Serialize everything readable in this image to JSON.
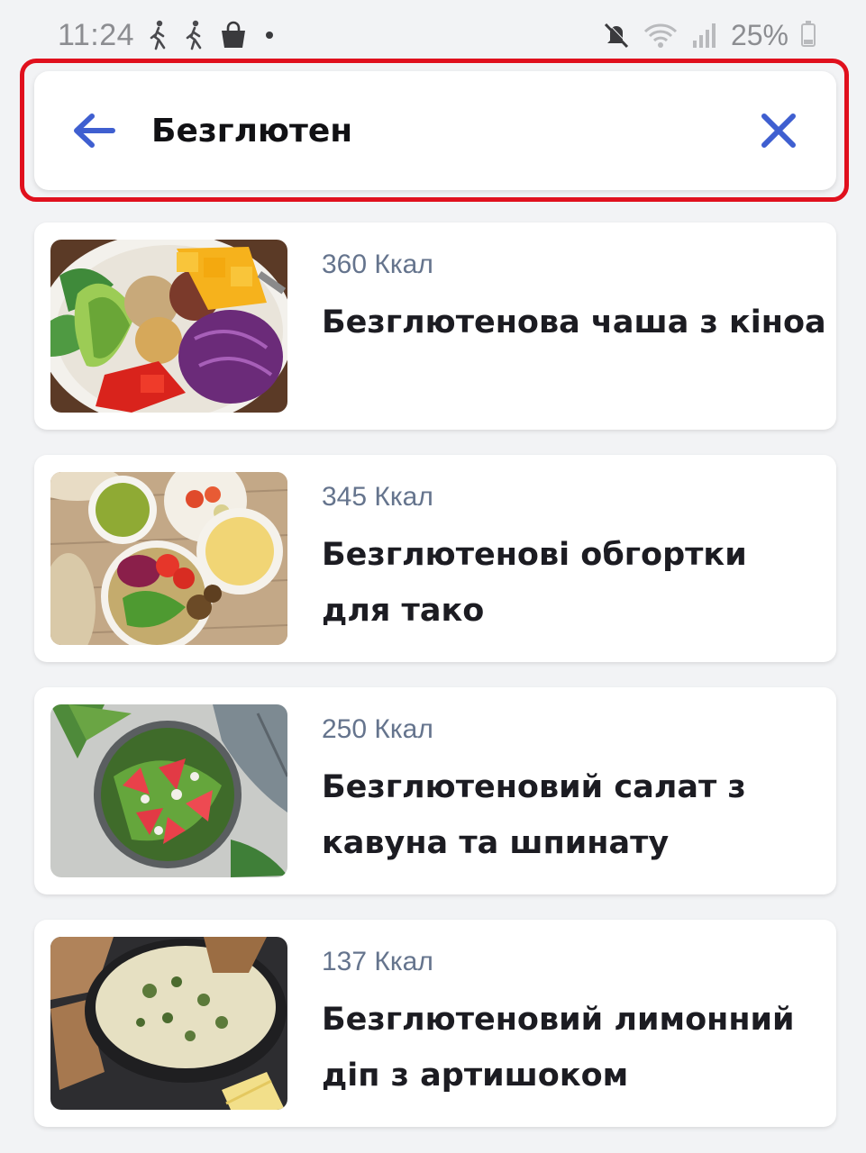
{
  "status_bar": {
    "time": "11:24",
    "battery": "25%",
    "battery_level": 0.25,
    "icons": [
      "walking-icon",
      "walking-icon",
      "shopping-bag-icon",
      "notification-dot",
      "mute-icon",
      "wifi-icon",
      "signal-icon",
      "battery-icon"
    ]
  },
  "search": {
    "value": "Безглютен",
    "back_icon": "arrow-left-icon",
    "clear_icon": "close-icon",
    "accent_color": "#3f5fd0",
    "highlight_color": "#e0101d"
  },
  "results": [
    {
      "kcal": "360 Ккал",
      "title": "Безглютенова чаша з кіноа",
      "image": "quinoa-bowl-photo"
    },
    {
      "kcal": "345 Ккал",
      "title": "Безглютенові обгортки для тако",
      "image": "taco-ingredients-photo"
    },
    {
      "kcal": "250 Ккал",
      "title": "Безглютеновий салат з кавуна та шпинату",
      "image": "watermelon-spinach-salad-photo"
    },
    {
      "kcal": "137 Ккал",
      "title": "Безглютеновий лимонний діп з артишоком",
      "image": "artichoke-dip-photo"
    }
  ]
}
